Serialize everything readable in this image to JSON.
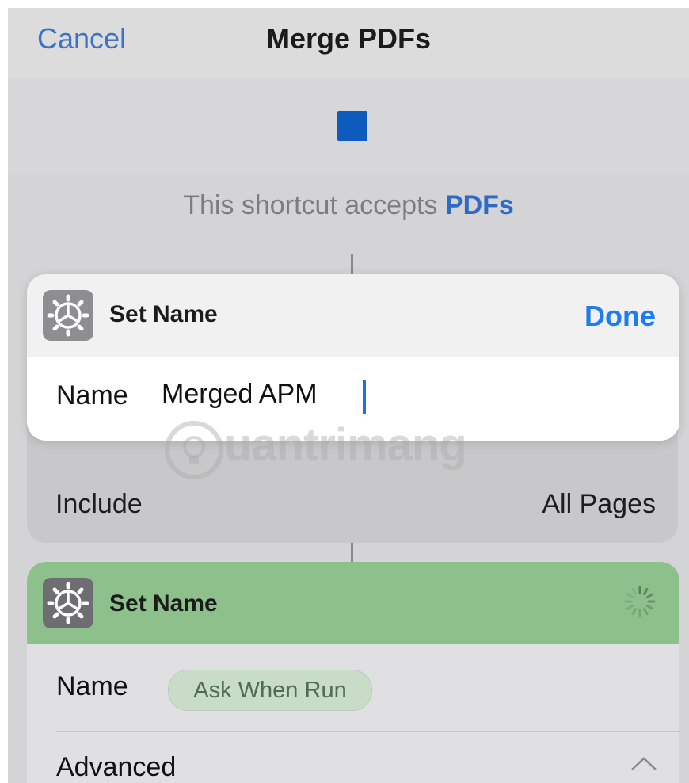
{
  "nav": {
    "cancel_label": "Cancel",
    "title": "Merge PDFs"
  },
  "accepts": {
    "prefix": "This shortcut accepts",
    "type": "PDFs"
  },
  "popup": {
    "title": "Set Name",
    "done_label": "Done",
    "field_label": "Name",
    "field_value": "Merged APM"
  },
  "include": {
    "label": "Include",
    "value": "All Pages"
  },
  "card2": {
    "title": "Set Name",
    "name_label": "Name",
    "name_value": "Ask When Run",
    "advanced_label": "Advanced"
  },
  "watermark": {
    "text": "uantrimang"
  },
  "colors": {
    "accent": "#1c7cf0",
    "stop": "#0d5bbd",
    "action_header": "#8ec08c"
  },
  "icons": [
    "stop-icon",
    "gear-icon",
    "spinner-icon",
    "chevron-up-icon",
    "lightbulb-icon"
  ]
}
